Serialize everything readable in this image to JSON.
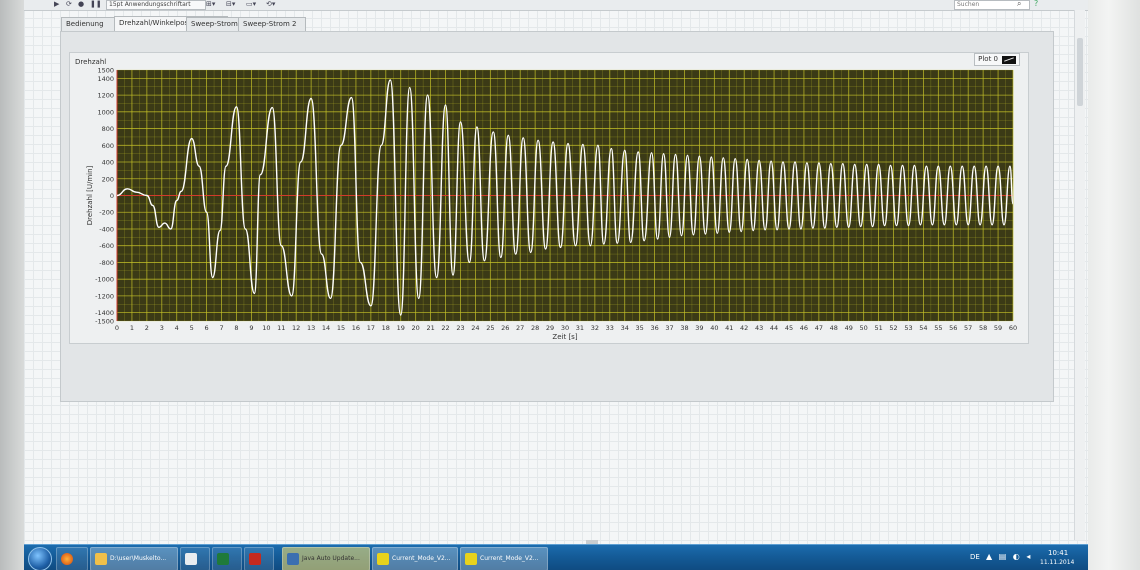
{
  "toolbar": {
    "font_select": "15pt Anwendungsschriftart",
    "search_placeholder": "Suchen",
    "help_icon": "?"
  },
  "tabs": [
    {
      "label": "Bedienung"
    },
    {
      "label": "Drehzahl/Winkelposition"
    },
    {
      "label": "Sweep-Strom"
    },
    {
      "label": "Sweep-Strom 2"
    }
  ],
  "active_tab": "Drehzahl/Winkelposition",
  "graph": {
    "title": "Drehzahl",
    "legend": "Plot 0"
  },
  "colors": {
    "plot_background": "#3b3a16",
    "grid": "#c6c328",
    "trace": "#ffffff",
    "zero_line": "#d23a2a"
  },
  "chart_data": {
    "type": "line",
    "title": "Drehzahl",
    "xlabel": "Zeit [s]",
    "ylabel": "Drehzahl [U/min]",
    "xlim": [
      0,
      60
    ],
    "ylim": [
      -1500,
      1500
    ],
    "x_ticks": [
      0,
      1,
      2,
      3,
      4,
      5,
      6,
      7,
      8,
      9,
      10,
      11,
      12,
      13,
      14,
      15,
      16,
      17,
      18,
      19,
      20,
      21,
      22,
      23,
      24,
      25,
      26,
      27,
      28,
      29,
      30,
      31,
      32,
      33,
      34,
      35,
      36,
      37,
      38,
      39,
      40,
      41,
      42,
      43,
      44,
      45,
      46,
      47,
      48,
      49,
      50,
      51,
      52,
      53,
      54,
      55,
      56,
      57,
      58,
      59,
      60
    ],
    "y_ticks": [
      1500,
      1400,
      1200,
      1000,
      800,
      600,
      400,
      200,
      0,
      -200,
      -400,
      -600,
      -800,
      -1000,
      -1200,
      -1400,
      -1500
    ],
    "grid": true,
    "series": [
      {
        "name": "Plot 0",
        "x": [
          0,
          0.7,
          1.3,
          2,
          2.4,
          2.8,
          3.2,
          3.6,
          4,
          4.3,
          5,
          5.5,
          6,
          6.4,
          6.9,
          7.3,
          8,
          8.6,
          9.2,
          9.6,
          10.4,
          11,
          11.7,
          12.3,
          13,
          13.7,
          14.3,
          15,
          15.7,
          16.3,
          17,
          17.7,
          18.3,
          19,
          19.6,
          20.2,
          20.8,
          21.4,
          22,
          22.5,
          23,
          23.6,
          24.1,
          24.6,
          25.2,
          25.7,
          26.2,
          26.7,
          27.2,
          27.7,
          28.2,
          28.7,
          29.2,
          29.7,
          30.2,
          30.7,
          31.2,
          31.7,
          32.2,
          32.6,
          33.1,
          33.5,
          34,
          34.4,
          34.9,
          35.3,
          35.8,
          36.2,
          36.6,
          37,
          37.4,
          37.8,
          38.2,
          38.6,
          39,
          39.4,
          39.8,
          40.2,
          40.6,
          41,
          41.4,
          41.8,
          42.2,
          42.6,
          43,
          43.4,
          43.8,
          44.2,
          44.6,
          45,
          45.4,
          45.8,
          46.2,
          46.6,
          47,
          47.4,
          47.8,
          48.2,
          48.6,
          49,
          49.4,
          49.8,
          50.2,
          50.6,
          51,
          51.4,
          51.8,
          52.2,
          52.6,
          53,
          53.4,
          53.8,
          54.2,
          54.6,
          55,
          55.4,
          55.8,
          56.2,
          56.6,
          57,
          57.4,
          57.8,
          58.2,
          58.6,
          59,
          59.4,
          59.8,
          60
        ],
        "y": [
          0,
          80,
          40,
          0,
          -120,
          -380,
          -330,
          -400,
          -60,
          50,
          680,
          350,
          -200,
          -980,
          -420,
          350,
          1060,
          -400,
          -1170,
          250,
          1050,
          -600,
          -1200,
          400,
          1160,
          -700,
          -1230,
          600,
          1170,
          -800,
          -1320,
          600,
          1380,
          -1430,
          1290,
          -1230,
          1200,
          -980,
          1080,
          -950,
          880,
          -800,
          820,
          -780,
          760,
          -740,
          720,
          -700,
          690,
          -680,
          660,
          -640,
          640,
          -620,
          620,
          -600,
          610,
          -600,
          600,
          -580,
          560,
          -570,
          540,
          -560,
          520,
          -540,
          510,
          -520,
          500,
          -500,
          490,
          -480,
          480,
          -470,
          470,
          -460,
          460,
          -450,
          450,
          -440,
          440,
          -430,
          430,
          -420,
          420,
          -410,
          410,
          -410,
          400,
          -400,
          400,
          -400,
          390,
          -390,
          390,
          -390,
          380,
          -380,
          380,
          -380,
          370,
          -370,
          370,
          -370,
          370,
          -360,
          360,
          -360,
          360,
          -360,
          360,
          -350,
          350,
          -350,
          350,
          -350,
          350,
          -350,
          350,
          -350,
          350,
          -350,
          350,
          -350,
          350,
          -350,
          350,
          -100
        ]
      }
    ]
  },
  "taskbar": {
    "apps": [
      {
        "label": ""
      },
      {
        "label": "D:\\user\\Muskelto..."
      },
      {
        "label": ""
      },
      {
        "label": ""
      },
      {
        "label": ""
      },
      {
        "label": "Java Auto Update..."
      },
      {
        "label": "Current_Mode_V2..."
      },
      {
        "label": "Current_Mode_V2..."
      }
    ],
    "language": "DE",
    "time": "10:41",
    "date": "11.11.2014"
  }
}
